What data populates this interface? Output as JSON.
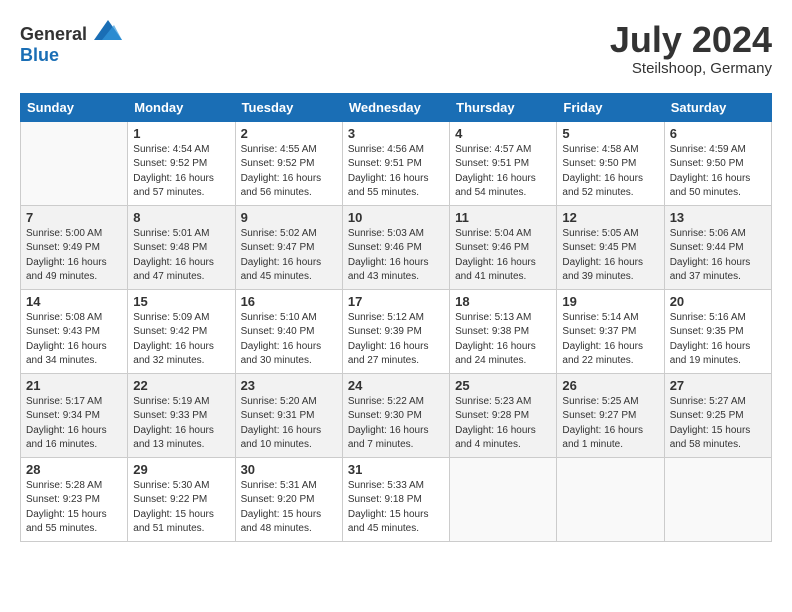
{
  "header": {
    "logo": {
      "general": "General",
      "blue": "Blue"
    },
    "title": "July 2024",
    "subtitle": "Steilshoop, Germany"
  },
  "calendar": {
    "headers": [
      "Sunday",
      "Monday",
      "Tuesday",
      "Wednesday",
      "Thursday",
      "Friday",
      "Saturday"
    ],
    "weeks": [
      {
        "days": [
          {
            "number": "",
            "empty": true
          },
          {
            "number": "1",
            "rise": "4:54 AM",
            "set": "9:52 PM",
            "daylight": "16 hours and 57 minutes."
          },
          {
            "number": "2",
            "rise": "4:55 AM",
            "set": "9:52 PM",
            "daylight": "16 hours and 56 minutes."
          },
          {
            "number": "3",
            "rise": "4:56 AM",
            "set": "9:51 PM",
            "daylight": "16 hours and 55 minutes."
          },
          {
            "number": "4",
            "rise": "4:57 AM",
            "set": "9:51 PM",
            "daylight": "16 hours and 54 minutes."
          },
          {
            "number": "5",
            "rise": "4:58 AM",
            "set": "9:50 PM",
            "daylight": "16 hours and 52 minutes."
          },
          {
            "number": "6",
            "rise": "4:59 AM",
            "set": "9:50 PM",
            "daylight": "16 hours and 50 minutes."
          }
        ]
      },
      {
        "days": [
          {
            "number": "7",
            "rise": "5:00 AM",
            "set": "9:49 PM",
            "daylight": "16 hours and 49 minutes."
          },
          {
            "number": "8",
            "rise": "5:01 AM",
            "set": "9:48 PM",
            "daylight": "16 hours and 47 minutes."
          },
          {
            "number": "9",
            "rise": "5:02 AM",
            "set": "9:47 PM",
            "daylight": "16 hours and 45 minutes."
          },
          {
            "number": "10",
            "rise": "5:03 AM",
            "set": "9:46 PM",
            "daylight": "16 hours and 43 minutes."
          },
          {
            "number": "11",
            "rise": "5:04 AM",
            "set": "9:46 PM",
            "daylight": "16 hours and 41 minutes."
          },
          {
            "number": "12",
            "rise": "5:05 AM",
            "set": "9:45 PM",
            "daylight": "16 hours and 39 minutes."
          },
          {
            "number": "13",
            "rise": "5:06 AM",
            "set": "9:44 PM",
            "daylight": "16 hours and 37 minutes."
          }
        ]
      },
      {
        "days": [
          {
            "number": "14",
            "rise": "5:08 AM",
            "set": "9:43 PM",
            "daylight": "16 hours and 34 minutes."
          },
          {
            "number": "15",
            "rise": "5:09 AM",
            "set": "9:42 PM",
            "daylight": "16 hours and 32 minutes."
          },
          {
            "number": "16",
            "rise": "5:10 AM",
            "set": "9:40 PM",
            "daylight": "16 hours and 30 minutes."
          },
          {
            "number": "17",
            "rise": "5:12 AM",
            "set": "9:39 PM",
            "daylight": "16 hours and 27 minutes."
          },
          {
            "number": "18",
            "rise": "5:13 AM",
            "set": "9:38 PM",
            "daylight": "16 hours and 24 minutes."
          },
          {
            "number": "19",
            "rise": "5:14 AM",
            "set": "9:37 PM",
            "daylight": "16 hours and 22 minutes."
          },
          {
            "number": "20",
            "rise": "5:16 AM",
            "set": "9:35 PM",
            "daylight": "16 hours and 19 minutes."
          }
        ]
      },
      {
        "days": [
          {
            "number": "21",
            "rise": "5:17 AM",
            "set": "9:34 PM",
            "daylight": "16 hours and 16 minutes."
          },
          {
            "number": "22",
            "rise": "5:19 AM",
            "set": "9:33 PM",
            "daylight": "16 hours and 13 minutes."
          },
          {
            "number": "23",
            "rise": "5:20 AM",
            "set": "9:31 PM",
            "daylight": "16 hours and 10 minutes."
          },
          {
            "number": "24",
            "rise": "5:22 AM",
            "set": "9:30 PM",
            "daylight": "16 hours and 7 minutes."
          },
          {
            "number": "25",
            "rise": "5:23 AM",
            "set": "9:28 PM",
            "daylight": "16 hours and 4 minutes."
          },
          {
            "number": "26",
            "rise": "5:25 AM",
            "set": "9:27 PM",
            "daylight": "16 hours and 1 minute."
          },
          {
            "number": "27",
            "rise": "5:27 AM",
            "set": "9:25 PM",
            "daylight": "15 hours and 58 minutes."
          }
        ]
      },
      {
        "days": [
          {
            "number": "28",
            "rise": "5:28 AM",
            "set": "9:23 PM",
            "daylight": "15 hours and 55 minutes."
          },
          {
            "number": "29",
            "rise": "5:30 AM",
            "set": "9:22 PM",
            "daylight": "15 hours and 51 minutes."
          },
          {
            "number": "30",
            "rise": "5:31 AM",
            "set": "9:20 PM",
            "daylight": "15 hours and 48 minutes."
          },
          {
            "number": "31",
            "rise": "5:33 AM",
            "set": "9:18 PM",
            "daylight": "15 hours and 45 minutes."
          },
          {
            "number": "",
            "empty": true
          },
          {
            "number": "",
            "empty": true
          },
          {
            "number": "",
            "empty": true
          }
        ]
      }
    ]
  }
}
